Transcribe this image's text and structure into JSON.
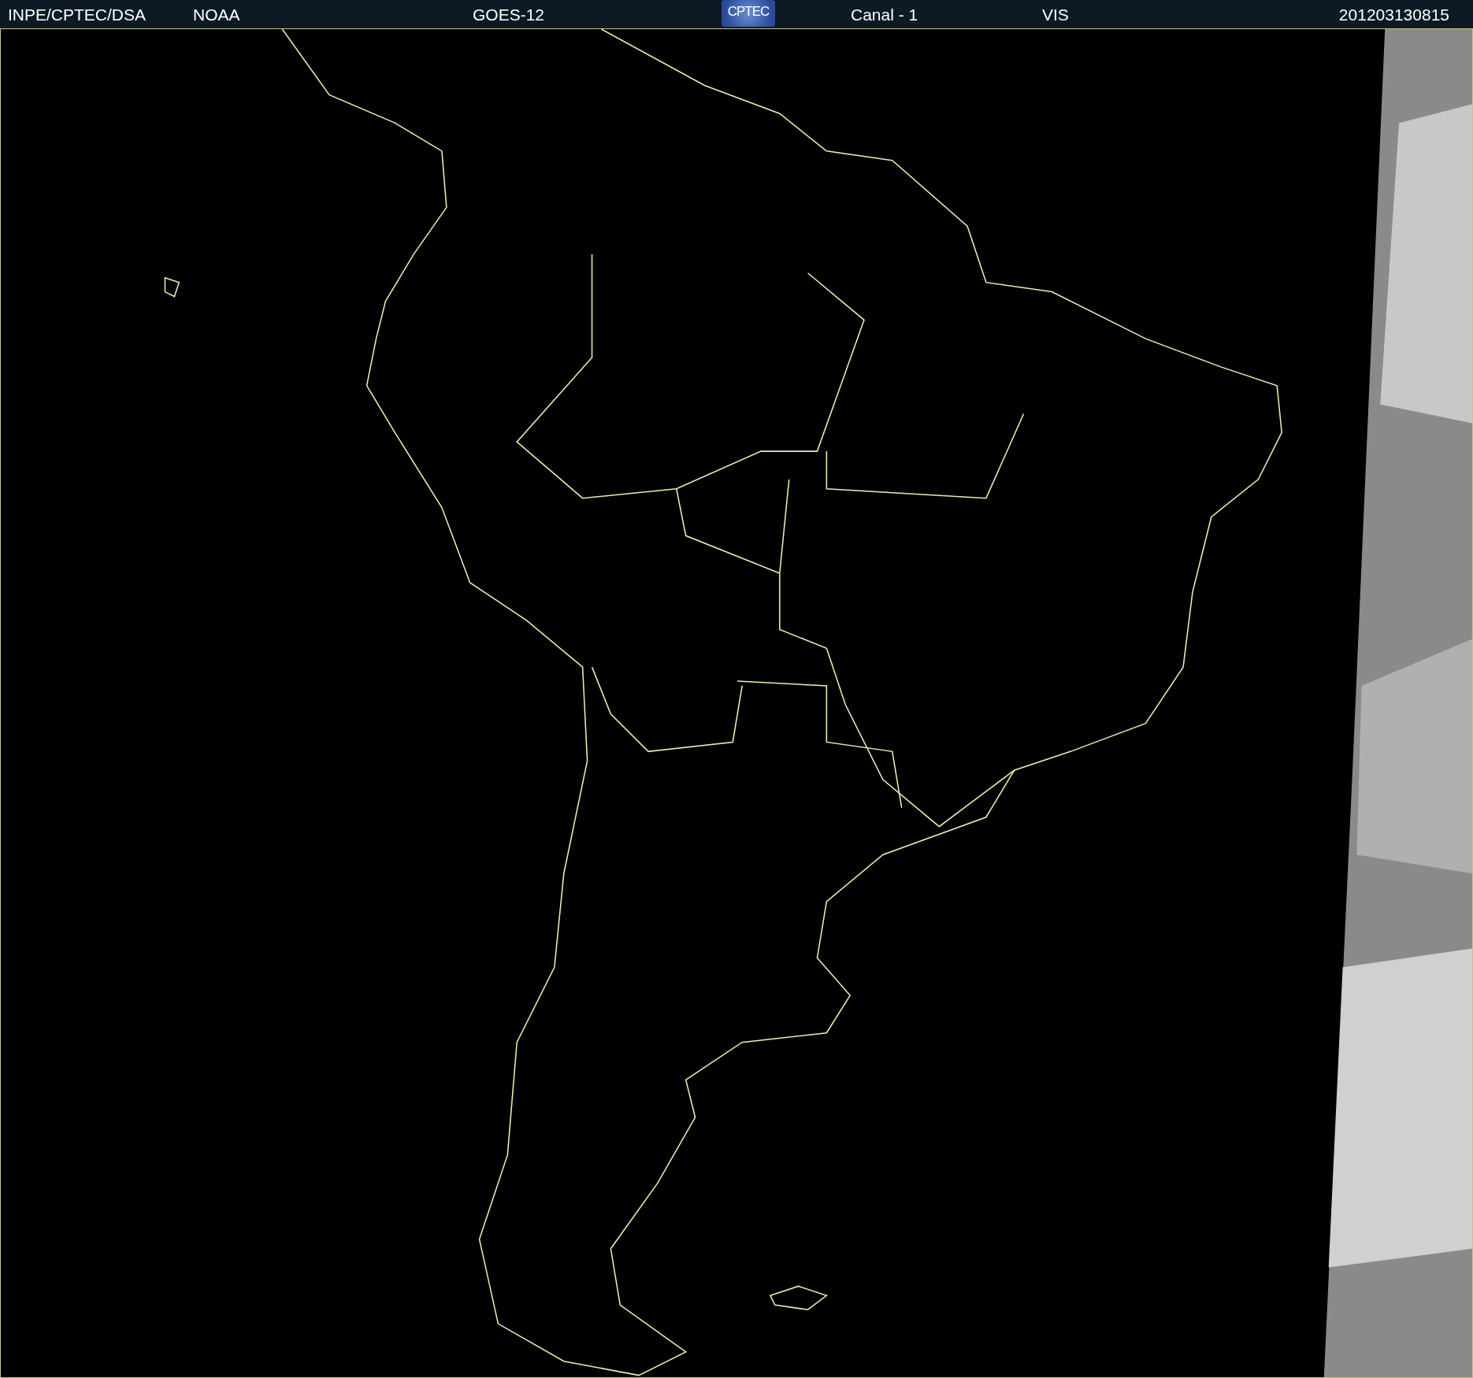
{
  "header": {
    "items": [
      {
        "kind": "text",
        "text": "INPE/CPTEC/DSA"
      },
      {
        "kind": "text",
        "text": "NOAA"
      },
      {
        "kind": "text",
        "text": "GOES-12"
      },
      {
        "kind": "logo",
        "text": "CPTEC"
      },
      {
        "kind": "text",
        "text": "Canal - 1"
      },
      {
        "kind": "text",
        "text": "VIS"
      },
      {
        "kind": "text",
        "text": "201203130815"
      }
    ]
  }
}
